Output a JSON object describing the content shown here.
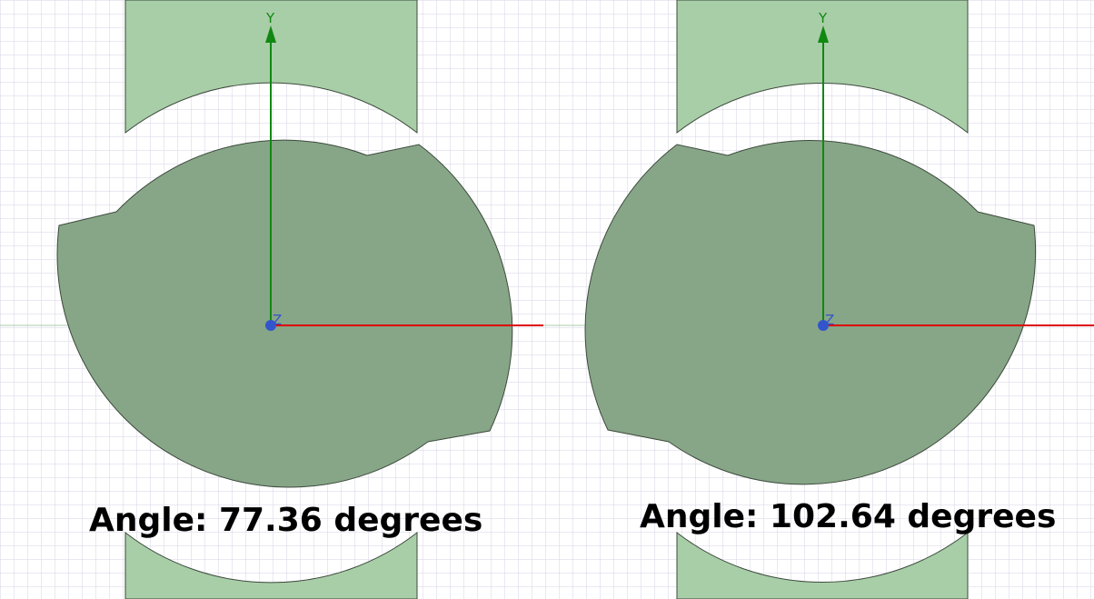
{
  "colors": {
    "background": "#ffffff",
    "grid": "#d6d3e6",
    "stator": "#a8cea8",
    "rotor": "#87a687",
    "outline": "#3d4a3d",
    "x_axis": "#dd0000",
    "y_axis": "#118811",
    "origin": "#3355cc"
  },
  "panels": [
    {
      "axis_y_label": "Y",
      "axis_z_label": "Z",
      "angle_caption": "Angle: 77.36 degrees"
    },
    {
      "axis_y_label": "Y",
      "axis_z_label": "Z",
      "angle_caption": "Angle: 102.64 degrees"
    }
  ]
}
